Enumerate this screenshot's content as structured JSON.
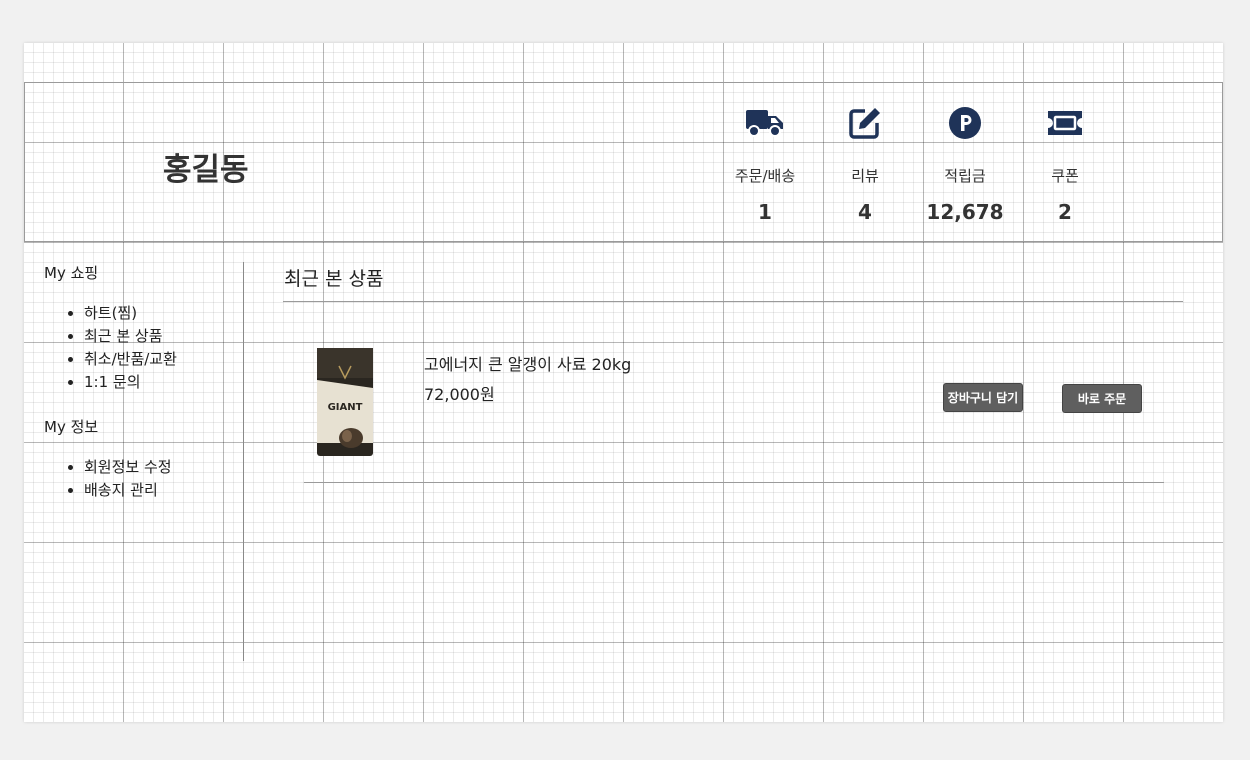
{
  "profile": {
    "name": "홍길동"
  },
  "stats": [
    {
      "icon": "truck-icon",
      "label": "주문/배송",
      "value": "1"
    },
    {
      "icon": "edit-icon",
      "label": "리뷰",
      "value": "4"
    },
    {
      "icon": "points-icon",
      "label": "적립금",
      "value": "12,678"
    },
    {
      "icon": "ticket-icon",
      "label": "쿠폰",
      "value": "2"
    }
  ],
  "sidebar": {
    "shopping_title": "My 쇼핑",
    "shopping_items": [
      "하트(찜)",
      "최근 본 상품",
      "취소/반품/교환",
      "1:1 문의"
    ],
    "info_title": "My 정보",
    "info_items": [
      "회원정보 수정",
      "배송지 관리"
    ]
  },
  "recent": {
    "title": "최근 본 상품",
    "product": {
      "name": "고에너지 큰 알갱이 사료 20kg",
      "price": "72,000원",
      "package_text": "GIANT",
      "cart_button": "장바구니 담기",
      "order_button": "바로 주문"
    }
  },
  "colors": {
    "icon": "#1f3358",
    "button": "#5f5f5f"
  }
}
